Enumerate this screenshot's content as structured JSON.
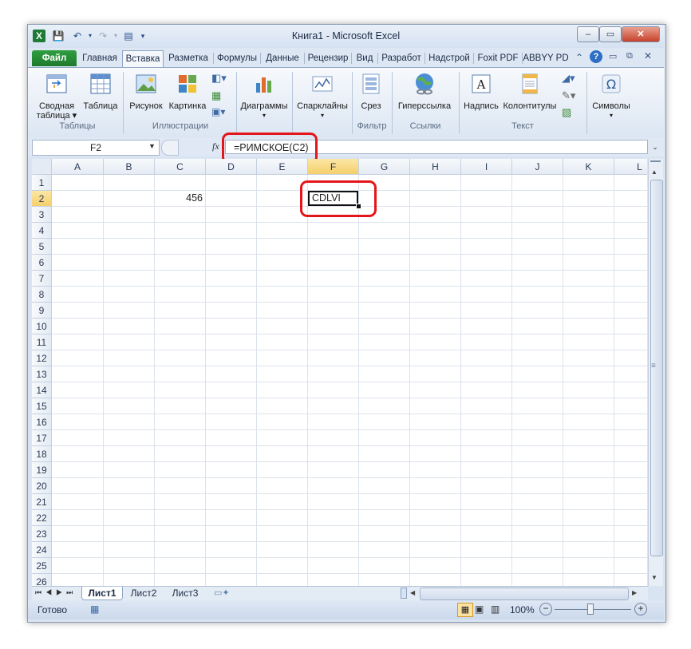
{
  "window": {
    "title": "Книга1 - Microsoft Excel",
    "controls": [
      "–",
      "▭",
      "✕"
    ]
  },
  "ribbon_tabs": [
    "Файл",
    "Главная",
    "Вставка",
    "Разметка",
    "Формулы",
    "Данные",
    "Рецензир",
    "Вид",
    "Разработ",
    "Надстрой",
    "Foxit PDF",
    "ABBYY PD"
  ],
  "active_tab": "Вставка",
  "ribbon": {
    "groups": {
      "tables": "Таблицы",
      "illustrations": "Иллюстрации",
      "filter": "Фильтр",
      "links": "Ссылки",
      "text": "Текст"
    },
    "buttons": {
      "pivot_line1": "Сводная",
      "pivot_line2": "таблица ▾",
      "table": "Таблица",
      "picture": "Рисунок",
      "clipart": "Картинка",
      "charts": "Диаграммы",
      "sparklines": "Спарклайны",
      "slicer": "Срез",
      "hyperlink": "Гиперссылка",
      "textbox": "Надпись",
      "headers": "Колонтитулы",
      "symbols": "Символы"
    }
  },
  "formula_bar": {
    "name_box": "F2",
    "fx": "fx",
    "formula": "=РИМСКОЕ(C2)"
  },
  "sheet": {
    "columns": [
      "A",
      "B",
      "C",
      "D",
      "E",
      "F",
      "G",
      "H",
      "I",
      "J",
      "K",
      "L"
    ],
    "rows": [
      "1",
      "2",
      "3",
      "4",
      "5",
      "6",
      "7",
      "8",
      "9",
      "10",
      "11",
      "12",
      "13",
      "14",
      "15",
      "16",
      "17",
      "18",
      "19",
      "20",
      "21",
      "22",
      "23",
      "24",
      "25",
      "26"
    ],
    "selected_cell": "F2",
    "cells": {
      "C2": "456",
      "F2": "CDLVI"
    }
  },
  "sheet_tabs": [
    "Лист1",
    "Лист2",
    "Лист3"
  ],
  "active_sheet": "Лист1",
  "status": {
    "ready": "Готово",
    "zoom": "100%"
  },
  "colors": {
    "highlight": "#e3171b",
    "file_tab": "#2f9e40",
    "selection_header": "#f5cf6b"
  }
}
